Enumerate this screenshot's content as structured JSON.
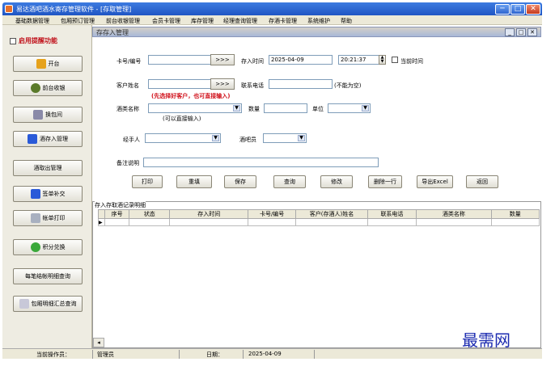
{
  "window": {
    "title": "易达酒吧酒水寄存管理软件 - [存取管理]",
    "controls": [
      "─",
      "□",
      "✕"
    ]
  },
  "menu": [
    "基础数据管理",
    "包厢预订管理",
    "前台收银管理",
    "会员卡管理",
    "库存管理",
    "经理查询管理",
    "存酒卡管理",
    "系统维护",
    "帮助"
  ],
  "sidebar": {
    "remind_label": "启用提醒功能",
    "buttons": [
      {
        "label": "开台",
        "icon": "open-table-icon"
      },
      {
        "label": "前台收银",
        "icon": "cashier-icon"
      },
      {
        "label": "换包间",
        "icon": "change-room-icon"
      },
      {
        "label": "酒存入管理",
        "icon": "deposit-icon"
      },
      {
        "label": "酒取出管理",
        "icon": ""
      },
      {
        "label": "签单补交",
        "icon": "sign-bill-icon"
      },
      {
        "label": "帐单打印",
        "icon": "print-icon"
      },
      {
        "label": "积分兑换",
        "icon": "points-icon"
      },
      {
        "label": "每笔结帐明细查询",
        "icon": ""
      },
      {
        "label": "包厢明细汇总查询",
        "icon": "summary-icon"
      }
    ]
  },
  "child_window": {
    "title": "存存入管理",
    "controls": [
      "_",
      "□",
      "✕"
    ]
  },
  "form": {
    "card_label": "卡号/编号",
    "card_value": "",
    "lookup_label": ">>>",
    "store_time_label": "存入时间",
    "store_date": "2025-04-09",
    "store_time": "20:21:37",
    "current_time_label": "当前时间",
    "customer_label": "客户姓名",
    "customer_value": "",
    "customer_lookup_label": ">>>",
    "phone_label": "联系电话",
    "phone_value": "",
    "phone_hint": "(不能为空)",
    "customer_hint": "(先选择好客户，也可直接输入)",
    "wine_label": "酒类名称",
    "wine_value": "",
    "wine_hint": "(可以直接输入)",
    "qty_label": "数量",
    "qty_value": "",
    "unit_label": "单位",
    "unit_value": "",
    "handler_label": "经手人",
    "handler_value": "",
    "bartender_label": "酒吧员",
    "bartender_value": "",
    "note_label": "备注说明",
    "note_value": ""
  },
  "actions": [
    "打印",
    "重填",
    "保存",
    "查询",
    "修改",
    "删除一行",
    "导出Excel",
    "返回"
  ],
  "grid": {
    "title": "存入存取酒记录明细",
    "columns": [
      "序号",
      "状态",
      "存入时间",
      "卡号/编号",
      "客户(存酒人)姓名",
      "联系电话",
      "酒类名称",
      "数量"
    ],
    "rows": []
  },
  "status": {
    "operator_label": "当前操作员：",
    "operator_value": "管理员",
    "date_label": "日期：",
    "date_value": "2025-04-09"
  },
  "watermark": "最需网",
  "colors": {
    "title_bar": "#1f55c4",
    "required_hint": "#d0101a",
    "watermark": "#1c2bb0"
  }
}
